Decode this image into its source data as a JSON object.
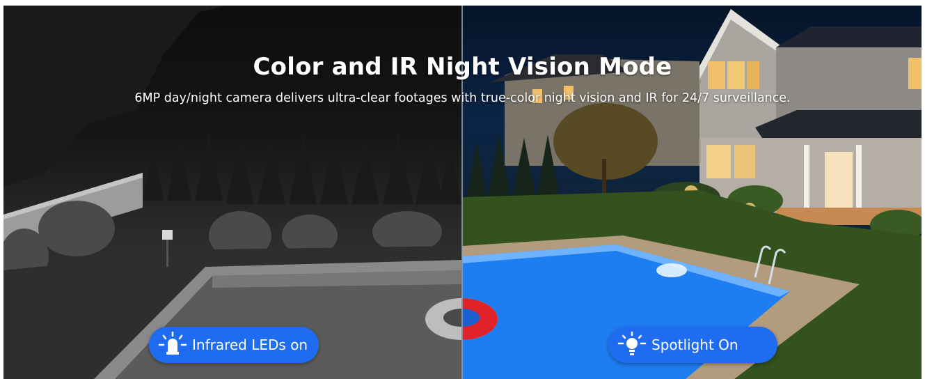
{
  "banner": {
    "title": "Color and IR Night Vision Mode",
    "subtitle": "6MP day/night camera delivers ultra-clear footages with true-color night vision and IR for 24/7 surveillance."
  },
  "modes": {
    "infrared": {
      "label": "Infrared LEDs on",
      "icon": "infrared-led-icon"
    },
    "spotlight": {
      "label": "Spotlight On",
      "icon": "spotlight-bulb-icon"
    }
  },
  "colors": {
    "pill_background": "#1f6cf0",
    "pool_color": "#1f7df2",
    "float_color": "#e0232b"
  }
}
